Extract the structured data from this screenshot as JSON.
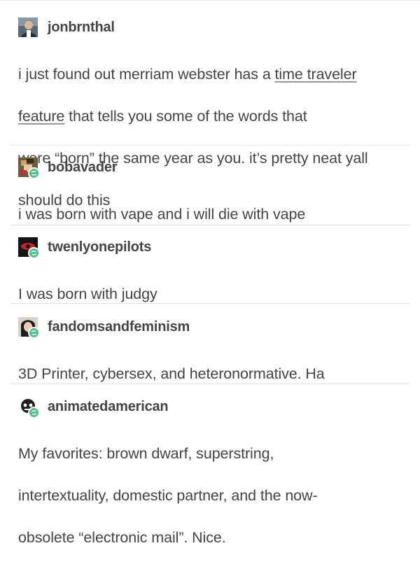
{
  "posts": [
    {
      "username": "jonbrnthal",
      "avatar": "portrait-avatar",
      "reblogged": false,
      "lines": [
        {
          "pre": "i just found out merriam webster has a ",
          "link": "time traveler",
          "post": ""
        },
        {
          "pre": "",
          "link": "feature",
          "post": " that tells you some of the words that"
        },
        {
          "pre": "were “born” the same year as you. it’s pretty neat yall",
          "link": "",
          "post": ""
        },
        {
          "pre": "should do this",
          "link": "",
          "post": ""
        }
      ]
    },
    {
      "username": "bobavader",
      "avatar": "pixel-art-avatar",
      "reblogged": true,
      "lines": [
        {
          "pre": "i was born with vape and i will die with vape",
          "link": "",
          "post": ""
        }
      ]
    },
    {
      "username": "twenlyonepilots",
      "avatar": "red-eye-avatar",
      "reblogged": true,
      "lines": [
        {
          "pre": "I was born with judgy",
          "link": "",
          "post": ""
        }
      ]
    },
    {
      "username": "fandomsandfeminism",
      "avatar": "dark-hair-avatar",
      "reblogged": true,
      "lines": [
        {
          "pre": "3D Printer, cybersex, and heteronormative. Ha",
          "link": "",
          "post": ""
        }
      ]
    },
    {
      "username": "animatedamerican",
      "avatar": "cartoon-avatar",
      "reblogged": true,
      "lines": [
        {
          "pre": "My favorites: brown dwarf, superstring,",
          "link": "",
          "post": ""
        },
        {
          "pre": "intertextuality, domestic partner, and the now-",
          "link": "",
          "post": ""
        },
        {
          "pre": "obsolete “electronic mail”.  Nice.",
          "link": "",
          "post": ""
        }
      ]
    }
  ],
  "colors": {
    "text": "#444444",
    "reblog_badge": "#56bc8a",
    "divider": "#e6e6e6"
  }
}
